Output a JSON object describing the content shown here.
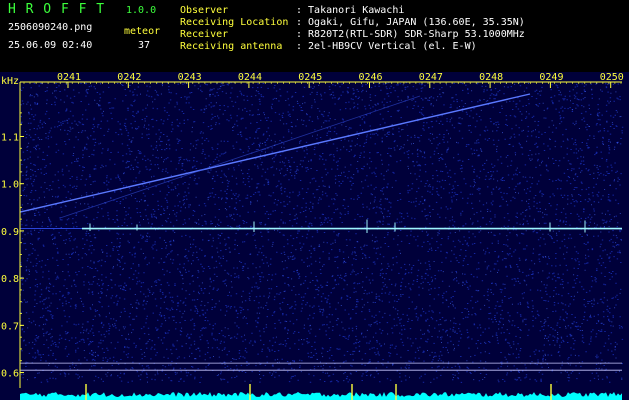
{
  "header": {
    "app_name": "H R O F F T",
    "version": "1.0.0",
    "filename": "2506090240.png",
    "datetime": "25.06.09 02:40",
    "count_label": "meteor",
    "count_value": "37",
    "info": [
      {
        "label": "Observer",
        "value": ": Takanori Kawachi"
      },
      {
        "label": "Receiving Location",
        "value": ": Ogaki, Gifu, JAPAN (136.60E, 35.35N)"
      },
      {
        "label": "Receiver",
        "value": ": R820T2(RTL-SDR) SDR-Sharp 53.1000MHz"
      },
      {
        "label": "Receiving antenna",
        "value": ": 2el-HB9CV Vertical (el. E-W)"
      }
    ]
  },
  "chart_data": {
    "type": "heatmap",
    "y_unit_label": "kHz",
    "x_tick_labels": [
      "0241",
      "0242",
      "0243",
      "0244",
      "0245",
      "0246",
      "0247",
      "0248",
      "0249",
      "0250"
    ],
    "y_tick_labels": [
      "1.1",
      "1.0",
      "0.9",
      "0.8",
      "0.7",
      "0.6"
    ],
    "y_ticks": [
      1.1,
      1.0,
      0.9,
      0.8,
      0.7,
      0.6
    ],
    "ylim": [
      0.58,
      1.19
    ],
    "carrier_line_khz": 0.905,
    "drift_line": {
      "start_khz": 0.94,
      "end_khz": 1.19
    },
    "reference_lines_khz": [
      0.62,
      0.605
    ],
    "colors": {
      "background": "#00003a",
      "noise": "#1c34c8",
      "carrier": "#9ff6ff",
      "axis": "#ffff3c",
      "spectrum": "#00ffff"
    }
  }
}
